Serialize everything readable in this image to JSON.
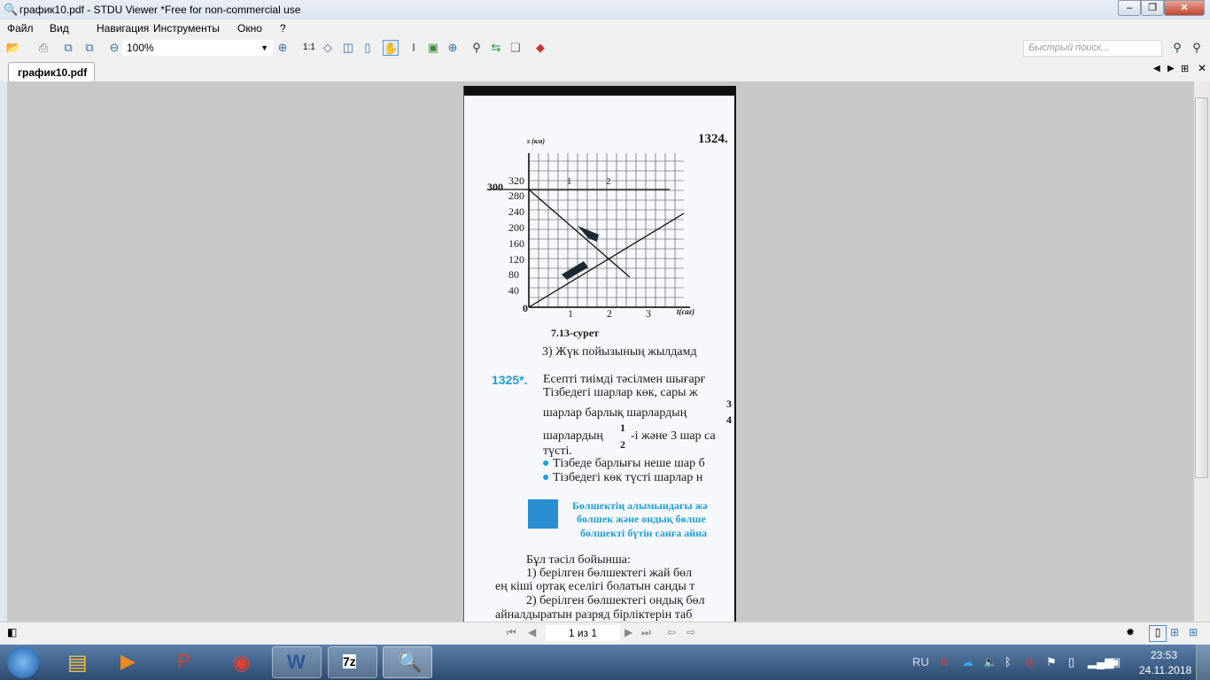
{
  "window": {
    "title": "график10.pdf - STDU Viewer *Free for non-commercial use",
    "controls": [
      "minimize",
      "maximize",
      "close"
    ]
  },
  "menu": [
    "Файл",
    "Вид",
    "Навигация",
    "Инструменты",
    "Окно",
    "?"
  ],
  "toolbar": {
    "zoom": "100%",
    "fit_label": "1:1",
    "search_placeholder": "Быстрый поиск..."
  },
  "tab": {
    "label": "график10.pdf"
  },
  "page": {
    "problem_1324": "1324.",
    "graph": {
      "ylabel": "s (км)",
      "xlabel": "t(сағ)",
      "yticks": [
        "40",
        "80",
        "120",
        "160",
        "200",
        "240",
        "280",
        "320"
      ],
      "y_marker": "300",
      "xticks": [
        "0",
        "1",
        "2",
        "3"
      ],
      "line_labels": [
        "1",
        "2"
      ],
      "caption": "7.13-сурет"
    },
    "q3": "3) Жүк пойызының жылдамд",
    "num_1325": "1325*.",
    "lines_1325": [
      "Есепті тиімді тәсілмен шығарғ",
      "Тізбедегі шарлар көк, сары ж",
      "шарлар барлық шарлардың",
      "шарлардың",
      "-і және 3 шар са",
      "түсті."
    ],
    "frac_a": {
      "num": "3",
      "den": "4"
    },
    "frac_b": {
      "num": "1",
      "den": "2"
    },
    "bullets": [
      "Тізбеде барлығы неше шар б",
      "Тізбедегі көк түсті шарлар н"
    ],
    "rule": [
      "Бөлшектің алымындағы жә",
      "бөлшек және ондық бөлше",
      "бөлшекті бүтін санға айна"
    ],
    "body": [
      "Бұл тәсіл бойынша:",
      "1) берілген бөлшектегі жай бөл",
      "ең кіші ортақ еселігі болатын санды т",
      "2) берілген бөлшектегі ондық бөл",
      "айналдыратын разряд бірліктерін таб"
    ]
  },
  "status": {
    "page_indicator": "1 из 1"
  },
  "taskbar": {
    "lang": "RU",
    "time": "23:53",
    "date": "24.11.2018"
  }
}
